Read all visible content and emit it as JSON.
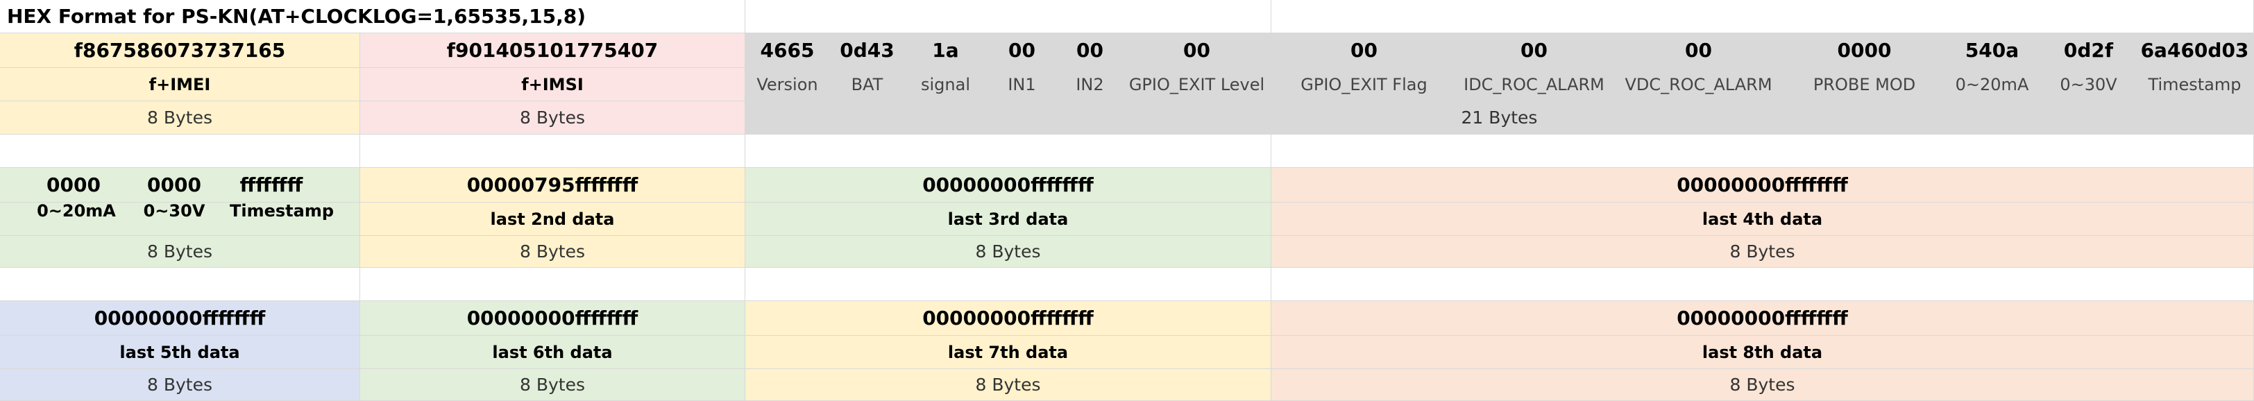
{
  "title": "HEX Format for PS-KN(AT+CLOCKLOG=1,65535,15,8)",
  "row1": {
    "imei": {
      "hex": "f867586073737165",
      "label": "f+IMEI",
      "bytes": "8 Bytes"
    },
    "imsi": {
      "hex": "f901405101775407",
      "label": "f+IMSI",
      "bytes": "8 Bytes"
    },
    "fields": [
      {
        "hex": "4665",
        "label": "Version"
      },
      {
        "hex": "0d43",
        "label": "BAT"
      },
      {
        "hex": "1a",
        "label": "signal"
      },
      {
        "hex": "00",
        "label": "IN1"
      },
      {
        "hex": "00",
        "label": "IN2"
      },
      {
        "hex": "00",
        "label": "GPIO_EXIT Level"
      },
      {
        "hex": "00",
        "label": "GPIO_EXIT Flag"
      },
      {
        "hex": "00",
        "label": "IDC_ROC_ALARM"
      },
      {
        "hex": "00",
        "label": "VDC_ROC_ALARM"
      },
      {
        "hex": "0000",
        "label": "PROBE MOD"
      },
      {
        "hex": "540a",
        "label": "0~20mA"
      },
      {
        "hex": "0d2f",
        "label": "0~30V"
      },
      {
        "hex": "6a460d03",
        "label": "Timestamp"
      }
    ],
    "fields_bytes": "21 Bytes"
  },
  "row2": {
    "first": {
      "parts": [
        {
          "hex": "0000",
          "label": "0~20mA"
        },
        {
          "hex": "0000",
          "label": "0~30V"
        },
        {
          "hex": "ffffffff",
          "label": "Timestamp"
        }
      ],
      "bytes": "8 Bytes"
    },
    "blocks": [
      {
        "hex": "00000795ffffffff",
        "label": "last 2nd data",
        "bytes": "8 Bytes"
      },
      {
        "hex": "00000000ffffffff",
        "label": "last 3rd data",
        "bytes": "8 Bytes"
      },
      {
        "hex": "00000000ffffffff",
        "label": "last 4th data",
        "bytes": "8 Bytes"
      }
    ]
  },
  "row3": {
    "blocks": [
      {
        "hex": "00000000ffffffff",
        "label": "last 5th data",
        "bytes": "8 Bytes"
      },
      {
        "hex": "00000000ffffffff",
        "label": "last 6th data",
        "bytes": "8 Bytes"
      },
      {
        "hex": "00000000ffffffff",
        "label": "last 7th data",
        "bytes": "8 Bytes"
      },
      {
        "hex": "00000000ffffffff",
        "label": "last 8th data",
        "bytes": "8 Bytes"
      }
    ]
  },
  "colors": {
    "yellow": "#fff2cc",
    "pink": "#fce4e4",
    "gray": "#d9d9d9",
    "green": "#e2efda",
    "salmon": "#fbe5d6",
    "blue": "#d9e1f2"
  }
}
